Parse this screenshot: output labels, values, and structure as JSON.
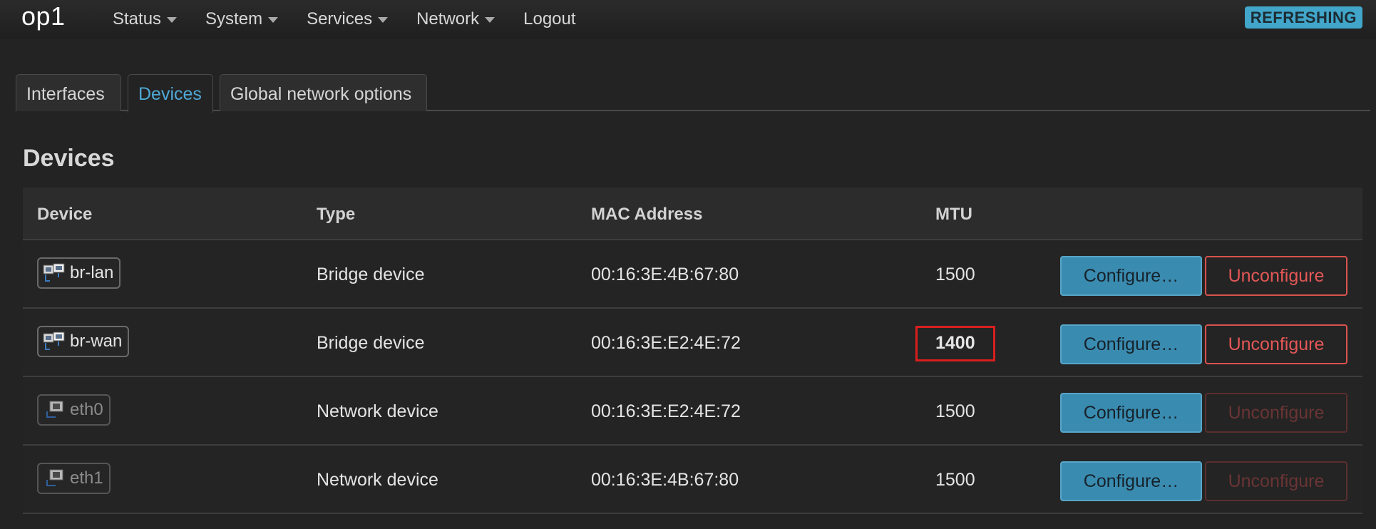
{
  "navbar": {
    "brand": "op1",
    "menu": [
      {
        "label": "Status",
        "has_caret": true
      },
      {
        "label": "System",
        "has_caret": true
      },
      {
        "label": "Services",
        "has_caret": true
      },
      {
        "label": "Network",
        "has_caret": true
      },
      {
        "label": "Logout",
        "has_caret": false
      }
    ],
    "indicator": "REFRESHING"
  },
  "tabs": [
    {
      "label": "Interfaces",
      "active": false
    },
    {
      "label": "Devices",
      "active": true
    },
    {
      "label": "Global network options",
      "active": false
    }
  ],
  "section": {
    "title": "Devices"
  },
  "table": {
    "headers": {
      "device": "Device",
      "type": "Type",
      "mac": "MAC Address",
      "mtu": "MTU"
    },
    "rows": [
      {
        "device": "br-lan",
        "icon": "bridge-icon",
        "type": "Bridge device",
        "mac": "00:16:3E:4B:67:80",
        "mtu": "1500",
        "highlighted": false,
        "unconfigure_enabled": true
      },
      {
        "device": "br-wan",
        "icon": "bridge-icon",
        "type": "Bridge device",
        "mac": "00:16:3E:E2:4E:72",
        "mtu": "1400",
        "highlighted": true,
        "unconfigure_enabled": true
      },
      {
        "device": "eth0",
        "icon": "ethernet-port-icon",
        "type": "Network device",
        "mac": "00:16:3E:E2:4E:72",
        "mtu": "1500",
        "highlighted": false,
        "unconfigure_enabled": false
      },
      {
        "device": "eth1",
        "icon": "ethernet-port-icon",
        "type": "Network device",
        "mac": "00:16:3E:4B:67:80",
        "mtu": "1500",
        "highlighted": false,
        "unconfigure_enabled": false
      }
    ],
    "configure_label": "Configure…",
    "unconfigure_label": "Unconfigure"
  },
  "colors": {
    "accent": "#4ea8d6",
    "configure_bg": "#3a8bb0",
    "unconfigure": "#e55757",
    "highlight_box": "#d91e1e",
    "indicator_bg": "#41a6c9"
  }
}
